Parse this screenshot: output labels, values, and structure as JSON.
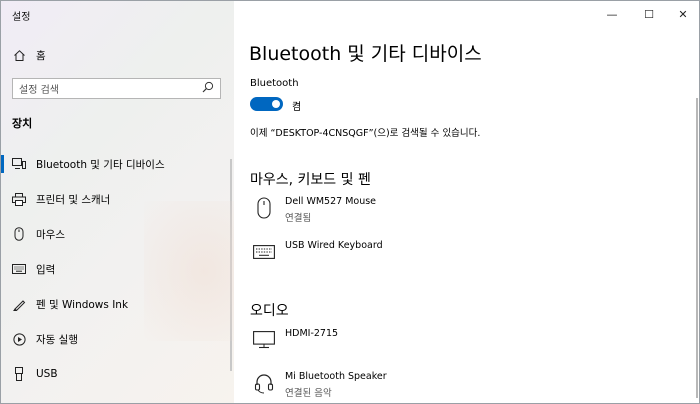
{
  "window": {
    "title": "설정",
    "controls": {
      "minimize": "—",
      "maximize": "☐",
      "close": "✕"
    }
  },
  "sidebar": {
    "home_label": "홈",
    "search_placeholder": "설정 검색",
    "section_title": "장치",
    "items": [
      {
        "label": "Bluetooth 및 기타 디바이스",
        "icon": "bluetooth-devices-icon",
        "active": true
      },
      {
        "label": "프린터 및 스캐너",
        "icon": "printer-icon"
      },
      {
        "label": "마우스",
        "icon": "mouse-icon"
      },
      {
        "label": "입력",
        "icon": "keyboard-icon"
      },
      {
        "label": "펜 및 Windows Ink",
        "icon": "pen-icon"
      },
      {
        "label": "자동 실행",
        "icon": "autoplay-icon"
      },
      {
        "label": "USB",
        "icon": "usb-icon"
      }
    ]
  },
  "main": {
    "title": "Bluetooth 및 기타 디바이스",
    "bluetooth_label": "Bluetooth",
    "toggle_state": "켬",
    "toggle_on": true,
    "discoverable_text": "이제 “DESKTOP-4CNSQGF”(으)로 검색될 수 있습니다.",
    "sections": [
      {
        "title": "마우스, 키보드 및 펜",
        "devices": [
          {
            "name": "Dell WM527 Mouse",
            "status": "연결됨",
            "icon": "mouse-icon"
          },
          {
            "name": "USB Wired Keyboard",
            "status": "",
            "icon": "keyboard-icon"
          }
        ]
      },
      {
        "title": "오디오",
        "devices": [
          {
            "name": "HDMI-2715",
            "status": "",
            "icon": "monitor-icon"
          },
          {
            "name": "Mi Bluetooth Speaker",
            "status": "연결된 음악",
            "icon": "headset-icon"
          }
        ]
      }
    ]
  },
  "colors": {
    "accent": "#0067c0"
  }
}
